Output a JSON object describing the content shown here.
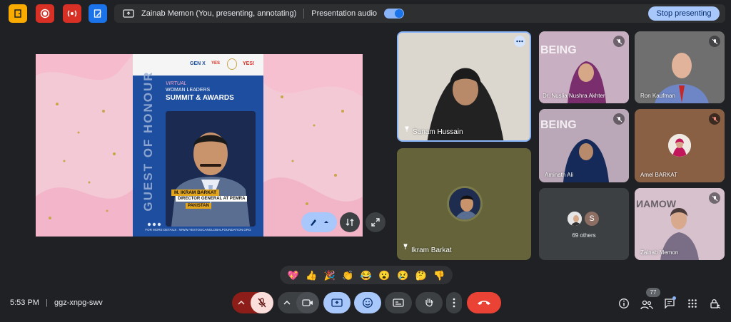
{
  "presentation_bar": {
    "presenter_label": "Zainab Memon (You, presenting, annotating)",
    "audio_label": "Presentation audio",
    "stop_label": "Stop presenting"
  },
  "slide": {
    "logo_labels": [
      "GEN X",
      "YES",
      "YES!"
    ],
    "vertical_title": "GUEST OF HONOUR",
    "virtual": "VIRTUAL",
    "women_leaders": "WOMAN LEADERS",
    "summit": "SUMMIT & AWARDS",
    "speaker_name": "M. IKRAM BARKAT",
    "speaker_role": "DIRECTOR GENERAL AT PEMRA",
    "speaker_country": "PAKISTAN",
    "footer": "FOR MORE DETAILS : WWW.YESTOUCANGLOBALFOUNDATION.ORG"
  },
  "participants": [
    {
      "name": "Sanam Hussain"
    },
    {
      "name": "Ikram Barkat"
    },
    {
      "name": "Dr. Nuslia Nushra Akhter"
    },
    {
      "name": "Ron Kaufman"
    },
    {
      "name": "Aminath Ali"
    },
    {
      "name": "Amel BARKAT"
    },
    {
      "name": "Zainab Memon"
    }
  ],
  "others": {
    "avatar_letter": "S",
    "label": "69 others"
  },
  "banner_text": {
    "being": "BEING",
    "woman": "WOMAN"
  },
  "reactions": [
    "💖",
    "👍",
    "🎉",
    "👏",
    "😂",
    "😮",
    "😢",
    "🤔",
    "👎"
  ],
  "footer": {
    "time": "5:53 PM",
    "separator": "|",
    "meeting_code": "ggz-xnpg-swv",
    "people_count": "77"
  },
  "colors": {
    "background": "#202124",
    "accent_blue": "#a8c7fa",
    "leave_red": "#ea4335",
    "mic_off_bg": "#f9dedc"
  }
}
